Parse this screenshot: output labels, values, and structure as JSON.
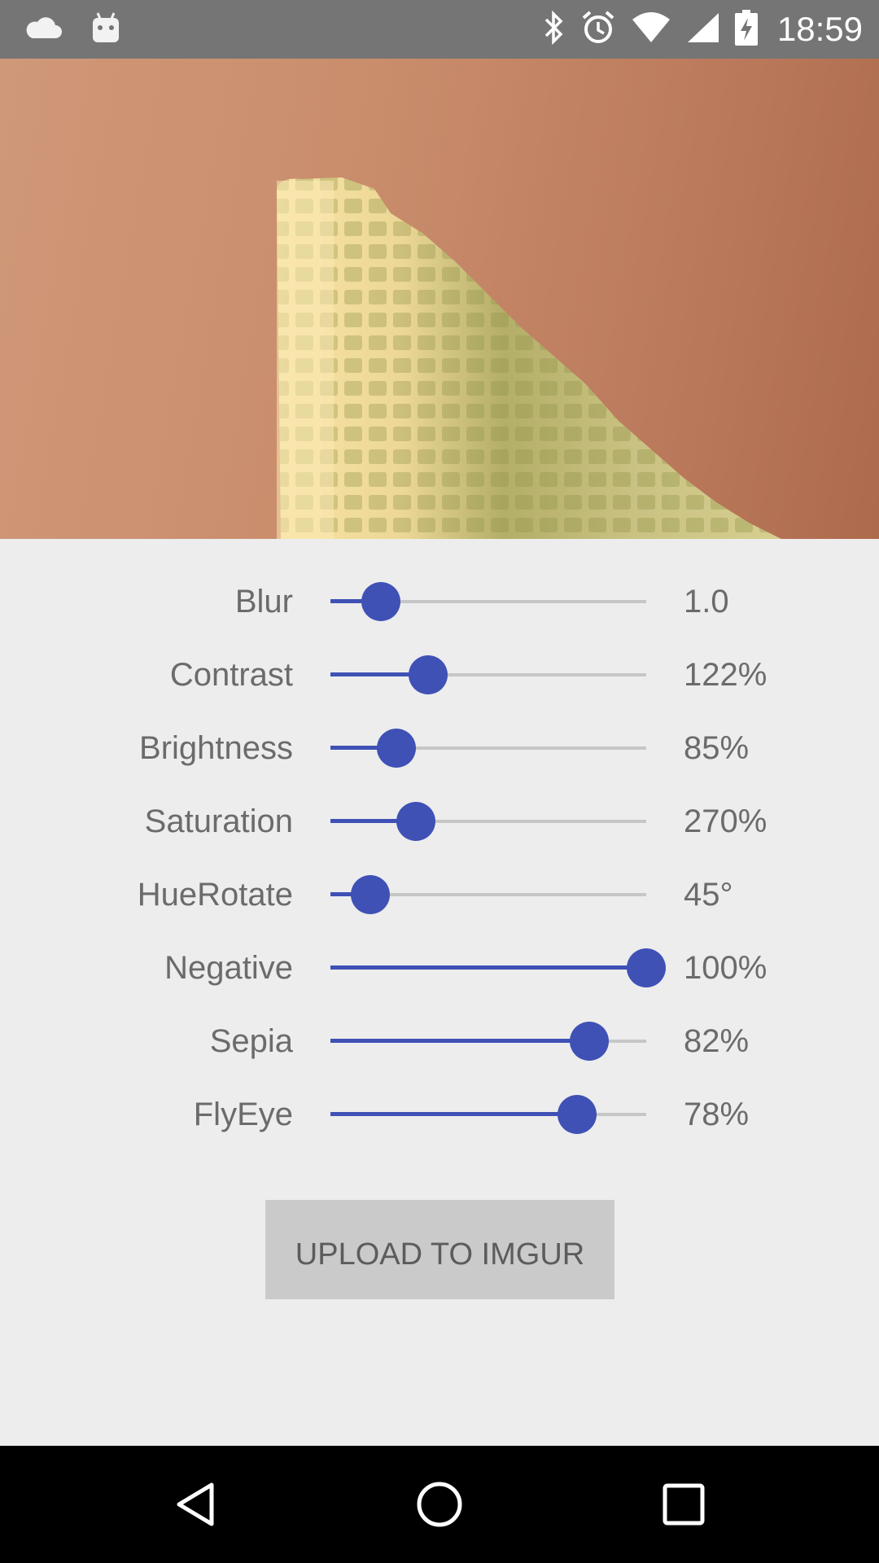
{
  "status_bar": {
    "time": "18:59",
    "icons": [
      "cloud-icon",
      "android-icon",
      "bluetooth-icon",
      "alarm-icon",
      "wifi-icon",
      "signal-icon",
      "battery-charging-icon"
    ]
  },
  "preview": {
    "description_icon": "filtered-photo"
  },
  "filters": [
    {
      "label": "Blur",
      "value": "1.0",
      "level": 0.16
    },
    {
      "label": "Contrast",
      "value": "122%",
      "level": 0.31
    },
    {
      "label": "Brightness",
      "value": "85%",
      "level": 0.21
    },
    {
      "label": "Saturation",
      "value": "270%",
      "level": 0.27
    },
    {
      "label": "HueRotate",
      "value": "45°",
      "level": 0.125
    },
    {
      "label": "Negative",
      "value": "100%",
      "level": 1.0
    },
    {
      "label": "Sepia",
      "value": "82%",
      "level": 0.82
    },
    {
      "label": "FlyEye",
      "value": "78%",
      "level": 0.78
    }
  ],
  "upload_button": {
    "label": "UPLOAD TO IMGUR"
  },
  "nav_bar": {
    "icons": [
      "back-icon",
      "home-icon",
      "recents-icon"
    ]
  },
  "colors": {
    "accent": "#3f51b5",
    "status_bar": "#757575",
    "background": "#ededed"
  }
}
